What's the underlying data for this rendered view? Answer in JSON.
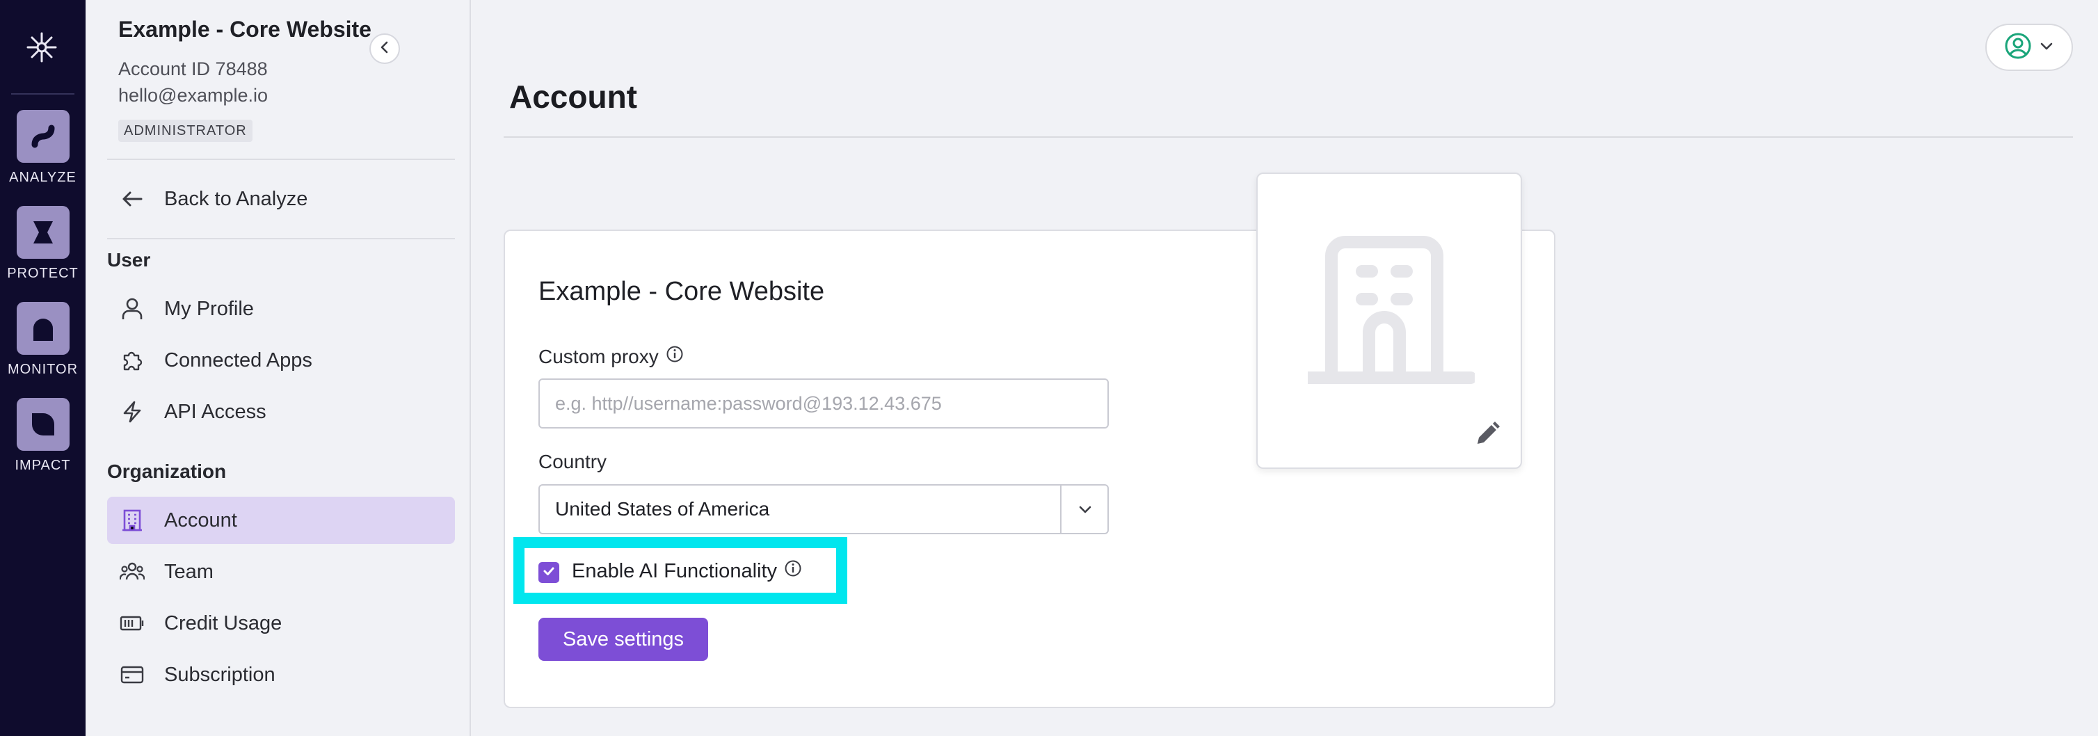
{
  "rail": {
    "items": [
      {
        "label": "ANALYZE",
        "icon": "analyze-icon"
      },
      {
        "label": "PROTECT",
        "icon": "protect-icon"
      },
      {
        "label": "MONITOR",
        "icon": "monitor-icon"
      },
      {
        "label": "IMPACT",
        "icon": "impact-icon"
      }
    ]
  },
  "sidebar": {
    "org_name": "Example - Core Website",
    "account_id": "Account ID 78488",
    "email": "hello@example.io",
    "role": "ADMINISTRATOR",
    "back_label": "Back to Analyze",
    "user_section": "User",
    "user_items": [
      {
        "label": "My Profile",
        "icon": "user-icon"
      },
      {
        "label": "Connected Apps",
        "icon": "puzzle-icon"
      },
      {
        "label": "API Access",
        "icon": "bolt-icon"
      }
    ],
    "org_section": "Organization",
    "org_items": [
      {
        "label": "Account",
        "icon": "building-icon",
        "active": true
      },
      {
        "label": "Team",
        "icon": "team-icon"
      },
      {
        "label": "Credit Usage",
        "icon": "battery-icon"
      },
      {
        "label": "Subscription",
        "icon": "card-icon"
      }
    ]
  },
  "main": {
    "title": "Account",
    "card_title": "Example - Core Website",
    "custom_proxy_label": "Custom proxy",
    "custom_proxy_value": "",
    "custom_proxy_placeholder": "e.g. http//username:password@193.12.43.675",
    "country_label": "Country",
    "country_value": "United States of America",
    "ai_label": "Enable AI Functionality",
    "ai_checked": true,
    "save_label": "Save settings"
  },
  "colors": {
    "accent": "#7d4ed6",
    "rail_bg": "#0f0c2d",
    "highlight": "#00e6ee",
    "active_nav": "#ddd4f3"
  }
}
